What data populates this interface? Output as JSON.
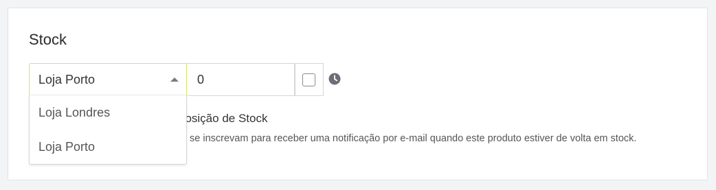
{
  "section": {
    "title": "Stock"
  },
  "location_select": {
    "selected": "Loja Porto",
    "options": [
      "Loja Londres",
      "Loja Porto"
    ]
  },
  "quantity": {
    "value": "0"
  },
  "restock": {
    "label_visible": "posição de Stock",
    "help_visible": "se inscrevam para receber uma notificação por e-mail quando este produto estiver de volta em stock."
  },
  "icons": {
    "caret": "caret-up-icon",
    "clock": "clock-icon",
    "checkbox": "checkbox-icon"
  },
  "colors": {
    "focus_border": "#cfe860",
    "text": "#333333",
    "icon": "#6b6f75"
  }
}
